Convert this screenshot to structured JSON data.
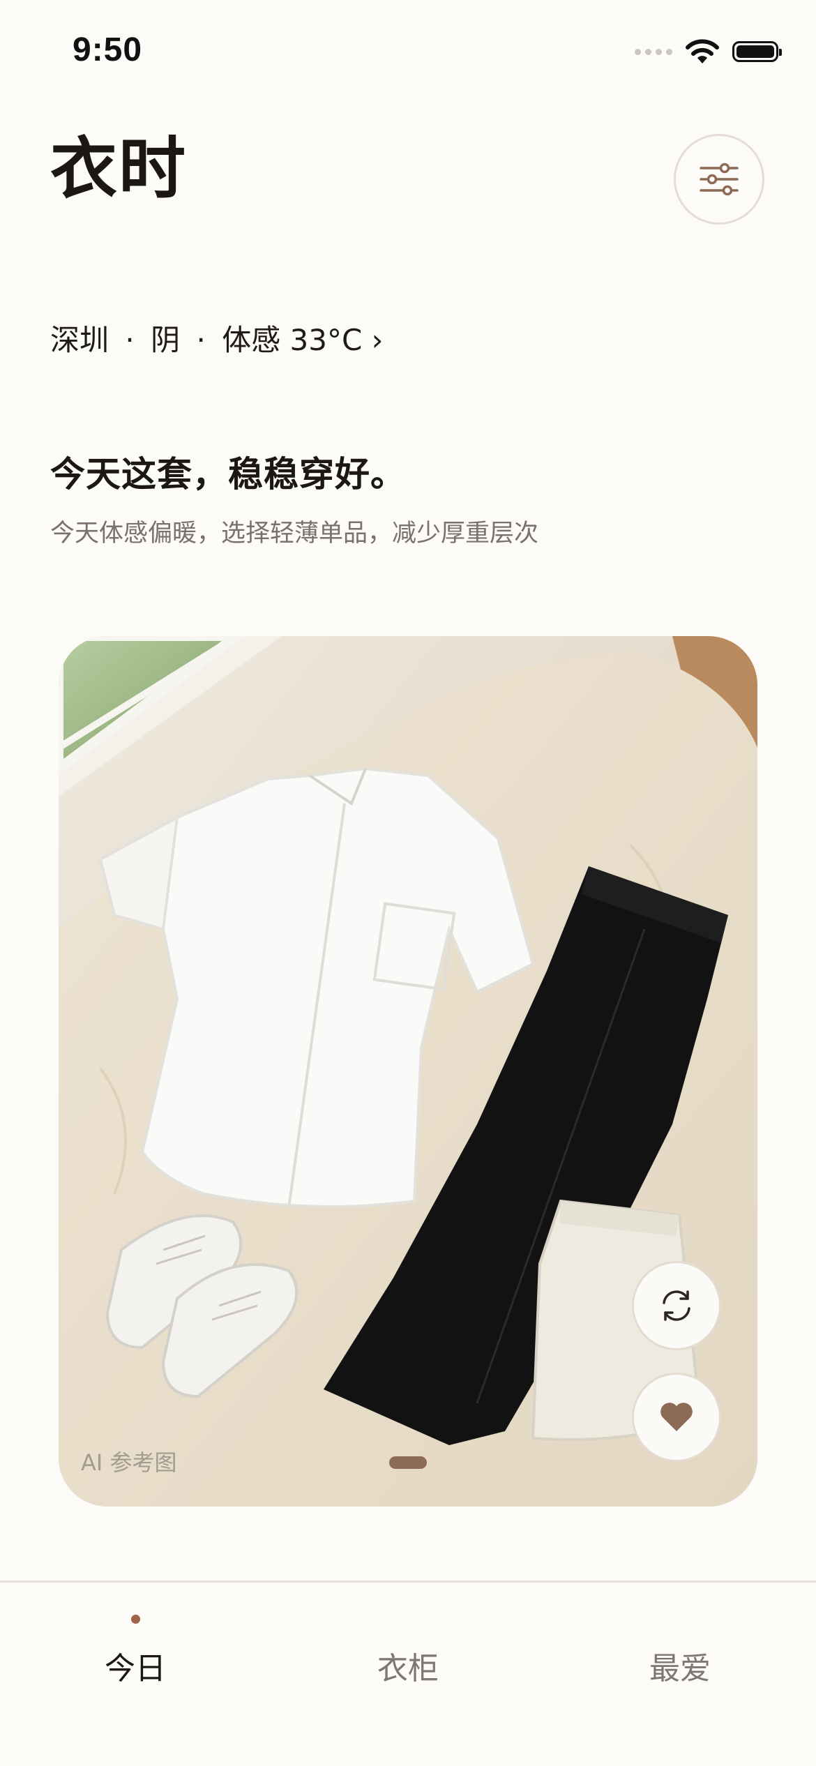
{
  "status_bar": {
    "time": "9:50",
    "icons": [
      "cellular-signal-icon",
      "wifi-icon",
      "battery-icon"
    ]
  },
  "header": {
    "title": "衣时",
    "filter_icon": "sliders-icon"
  },
  "weather": {
    "city": "深圳",
    "condition": "阴",
    "feels_like": "体感 33°C",
    "separator": "·",
    "chevron": "›"
  },
  "recommendation": {
    "headline": "今天这套，稳稳穿好。",
    "subtitle": "今天体感偏暖，选择轻薄单品，减少厚重层次"
  },
  "outfit_card": {
    "image_description_icon": "outfit-photo",
    "ai_label": "AI 参考图",
    "page_count": 1,
    "current_page": 1,
    "refresh_icon": "refresh-icon",
    "favorite_icon": "heart-icon"
  },
  "tab_bar": {
    "tabs": [
      {
        "label": "今日",
        "active": true
      },
      {
        "label": "衣柜",
        "active": false
      },
      {
        "label": "最爱",
        "active": false
      }
    ]
  },
  "colors": {
    "background": "#FCFBF8",
    "accent": "#A0644A",
    "heart": "#8D6A55",
    "text_primary": "#1A1714",
    "text_secondary": "#7A716A"
  }
}
